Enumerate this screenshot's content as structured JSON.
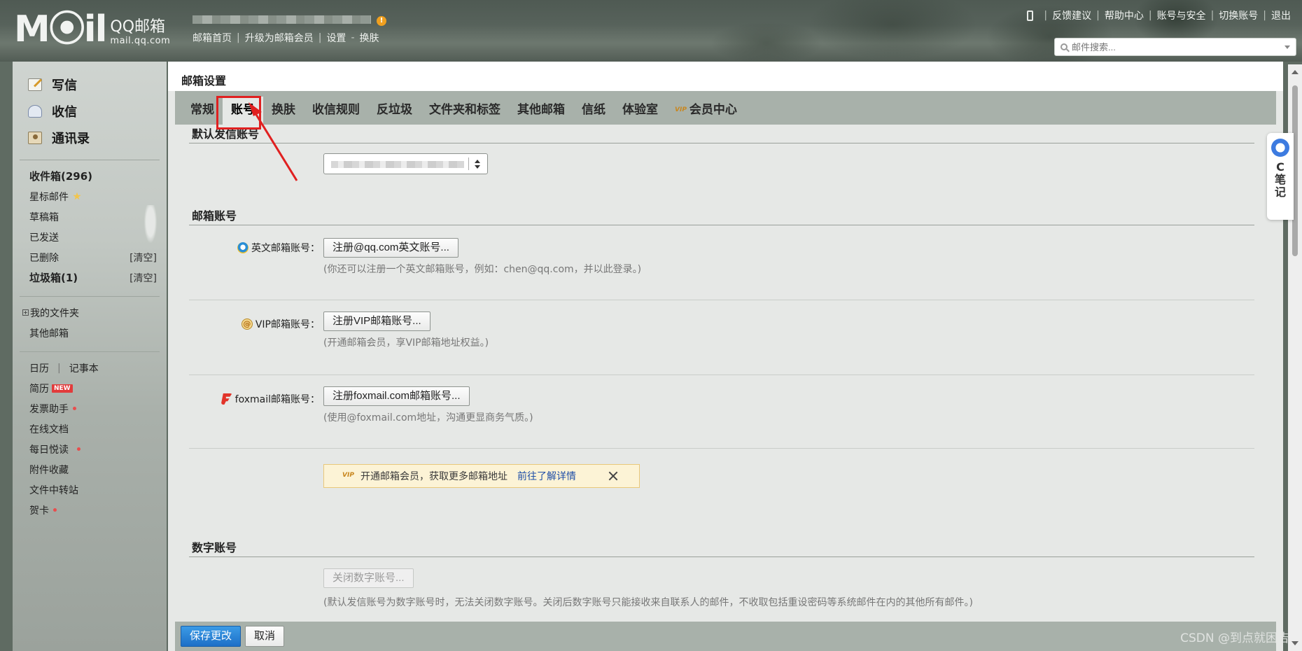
{
  "header": {
    "logo_mark": "M⦿il",
    "logo_cn": "QQ邮箱",
    "logo_en": "mail.qq.com",
    "warn_badge": "!",
    "nav": [
      "邮箱首页",
      "升级为邮箱会员",
      "设置",
      "换肤"
    ],
    "right_links": [
      "反馈建议",
      "帮助中心",
      "账号与安全",
      "切换账号",
      "退出"
    ],
    "search_placeholder": "邮件搜索..."
  },
  "sidebar": {
    "actions": [
      {
        "label": "写信",
        "icon": "compose-icon"
      },
      {
        "label": "收信",
        "icon": "inbox-icon"
      },
      {
        "label": "通讯录",
        "icon": "contacts-icon"
      }
    ],
    "folders": {
      "inbox": "收件箱(296)",
      "starred": "星标邮件",
      "drafts": "草稿箱",
      "sent": "已发送",
      "deleted": "已删除",
      "deleted_clear": "[清空]",
      "spam": "垃圾箱(1)",
      "spam_clear": "[清空]"
    },
    "my_folders": "我的文件夹",
    "other_mail": "其他邮箱",
    "calendar": "日历",
    "notes": "记事本",
    "resume": "简历",
    "resume_badge": "NEW",
    "invoice": "发票助手",
    "docs": "在线文档",
    "daily": "每日悦读",
    "attachments": "附件收藏",
    "transfer": "文件中转站",
    "cards": "贺卡"
  },
  "main": {
    "title": "邮箱设置",
    "tabs": [
      {
        "label": "常规",
        "active": false
      },
      {
        "label": "账号",
        "active": true
      },
      {
        "label": "换肤",
        "active": false
      },
      {
        "label": "收信规则",
        "active": false
      },
      {
        "label": "反垃圾",
        "active": false
      },
      {
        "label": "文件夹和标签",
        "active": false
      },
      {
        "label": "其他邮箱",
        "active": false
      },
      {
        "label": "信纸",
        "active": false
      },
      {
        "label": "体验室",
        "active": false
      },
      {
        "label": "会员中心",
        "active": false
      }
    ],
    "vip_mark": "VIP",
    "default_sender": {
      "heading": "默认发信账号"
    },
    "mail_accounts": {
      "heading": "邮箱账号",
      "english": {
        "label": "英文邮箱账号：",
        "button": "注册@qq.com英文账号...",
        "hint": "(你还可以注册一个英文邮箱账号，例如：chen@qq.com，并以此登录。)"
      },
      "vip": {
        "label": "VIP邮箱账号：",
        "icon_text": "@",
        "button": "注册VIP邮箱账号...",
        "hint": "(开通邮箱会员，享VIP邮箱地址权益。)"
      },
      "foxmail": {
        "label": "foxmail邮箱账号：",
        "button": "注册foxmail.com邮箱账号...",
        "hint": "(使用@foxmail.com地址，沟通更显商务气质。)"
      },
      "promo": {
        "text": "开通邮箱会员，获取更多邮箱地址",
        "link": "前往了解详情"
      }
    },
    "digital": {
      "heading": "数字账号",
      "button": "关闭数字账号...",
      "hint": "(默认发信账号为数字账号时，无法关闭数字账号。关闭后数字账号只能接收来自联系人的邮件，不收取包括重设密码等系统邮件在内的其他所有邮件。)"
    },
    "save_label": "保存更改",
    "cancel_label": "取消"
  },
  "note_widget": [
    "C",
    "笔",
    "记"
  ],
  "watermark": "CSDN @到点就困告",
  "colors": {
    "highlight": "#e02020",
    "save_button": "#1d6fc7",
    "tab_bar": "#a8b1aa",
    "promo_bg": "#fcf3d6"
  }
}
